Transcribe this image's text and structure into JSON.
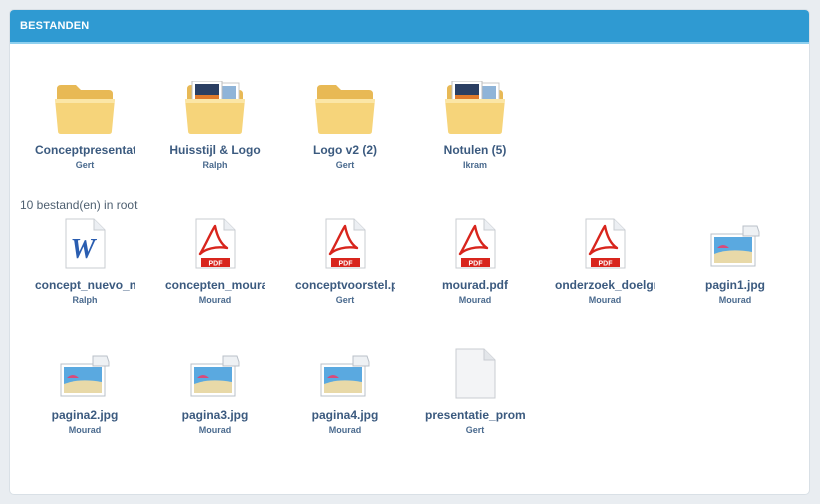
{
  "header": {
    "title": "BESTANDEN"
  },
  "folders": [
    {
      "name": "Conceptpresentatie",
      "owner": "Gert",
      "icon": "folder-icon"
    },
    {
      "name": "Huisstijl & Logo",
      "owner": "Ralph",
      "icon": "folder-images-icon"
    },
    {
      "name": "Logo v2 (2)",
      "owner": "Gert",
      "icon": "folder-icon"
    },
    {
      "name": "Notulen (5)",
      "owner": "Ikram",
      "icon": "folder-images-icon"
    }
  ],
  "file_count_label": "10 bestand(en) in root",
  "files": [
    {
      "name": "concept_nuevo_mourad.doc",
      "owner": "Ralph",
      "icon": "word-document-icon"
    },
    {
      "name": "concepten_mourad.pdf",
      "owner": "Mourad",
      "icon": "pdf-icon"
    },
    {
      "name": "conceptvoorstel.pdf",
      "owner": "Gert",
      "icon": "pdf-icon"
    },
    {
      "name": "mourad.pdf",
      "owner": "Mourad",
      "icon": "pdf-icon"
    },
    {
      "name": "onderzoek_doelgroep.pdf",
      "owner": "Mourad",
      "icon": "pdf-icon"
    },
    {
      "name": "pagin1.jpg",
      "owner": "Mourad",
      "icon": "image-icon"
    },
    {
      "name": "pagina2.jpg",
      "owner": "Mourad",
      "icon": "image-icon"
    },
    {
      "name": "pagina3.jpg",
      "owner": "Mourad",
      "icon": "image-icon"
    },
    {
      "name": "pagina4.jpg",
      "owner": "Mourad",
      "icon": "image-icon"
    },
    {
      "name": "presentatie_prompt",
      "owner": "Gert",
      "icon": "blank-file-icon"
    }
  ],
  "pdf_badge": "PDF",
  "word_letter": "W",
  "colors": {
    "header_bg": "#2f9ad2",
    "name_text": "#3b5a7f",
    "folder": "#f6d47a",
    "pdf_red": "#d8251d"
  }
}
